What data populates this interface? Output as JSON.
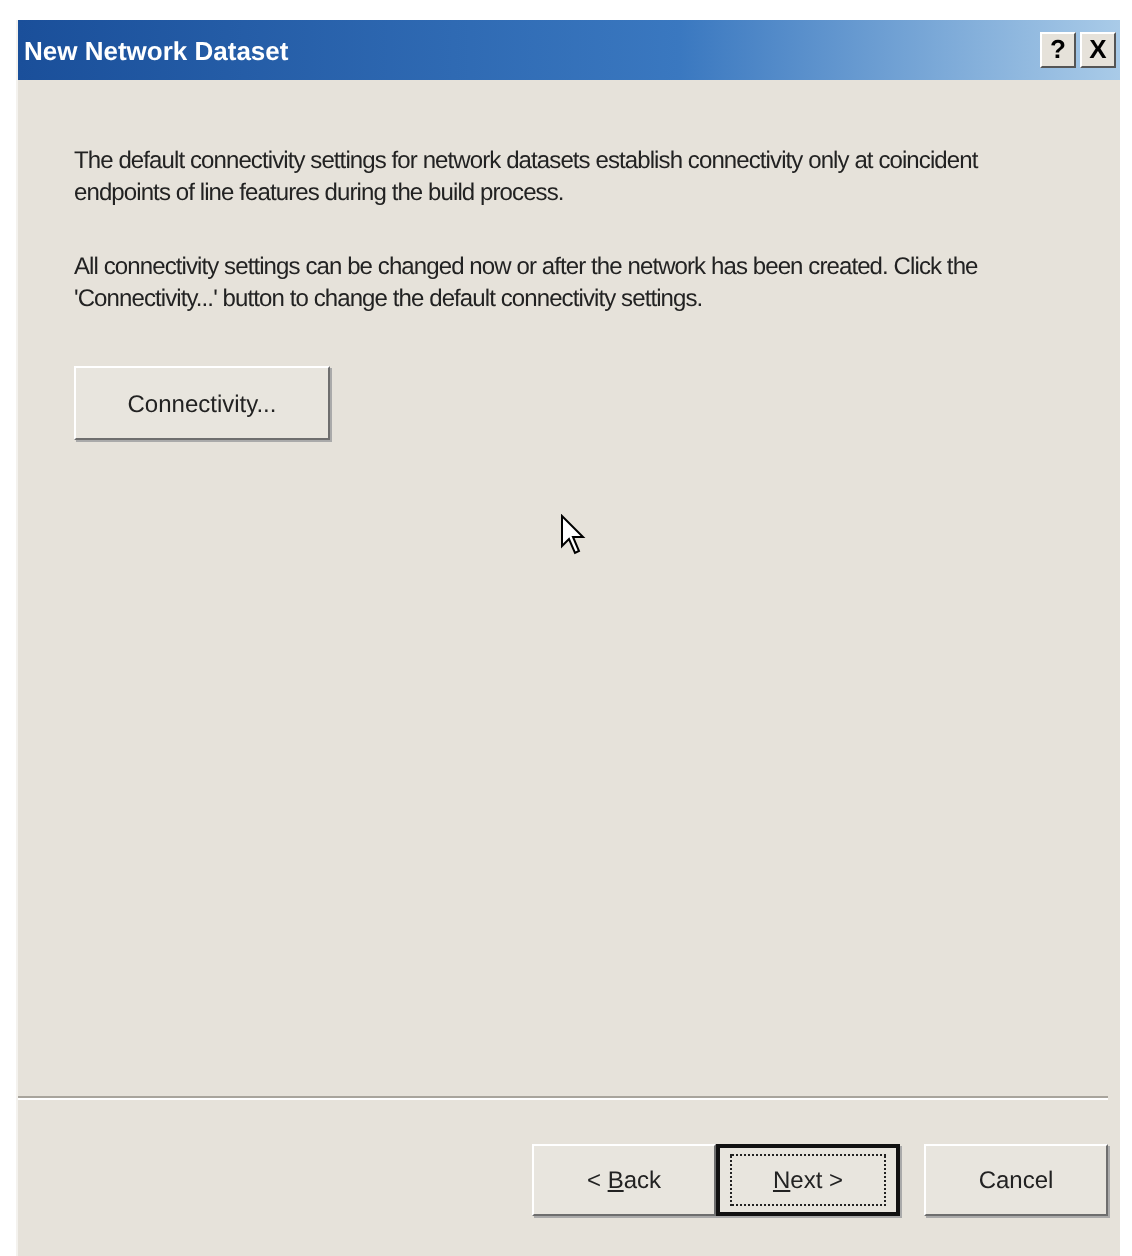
{
  "window": {
    "title": "New Network Dataset",
    "help_button": "?",
    "close_button": "X"
  },
  "paragraphs": [
    "The default connectivity settings for network datasets establish connectivity only at coincident endpoints of line features during the build process.",
    "All connectivity settings can be changed now or after the network has been created.  Click the 'Connectivity...' button to change the default connectivity settings."
  ],
  "connectivity_button": "Connectivity...",
  "buttons": [
    {
      "before": "< ",
      "key": "B",
      "after": "ack",
      "default": false
    },
    {
      "key": "N",
      "after": "ext >",
      "default": true
    },
    {
      "before": "Cancel",
      "default": false
    }
  ]
}
